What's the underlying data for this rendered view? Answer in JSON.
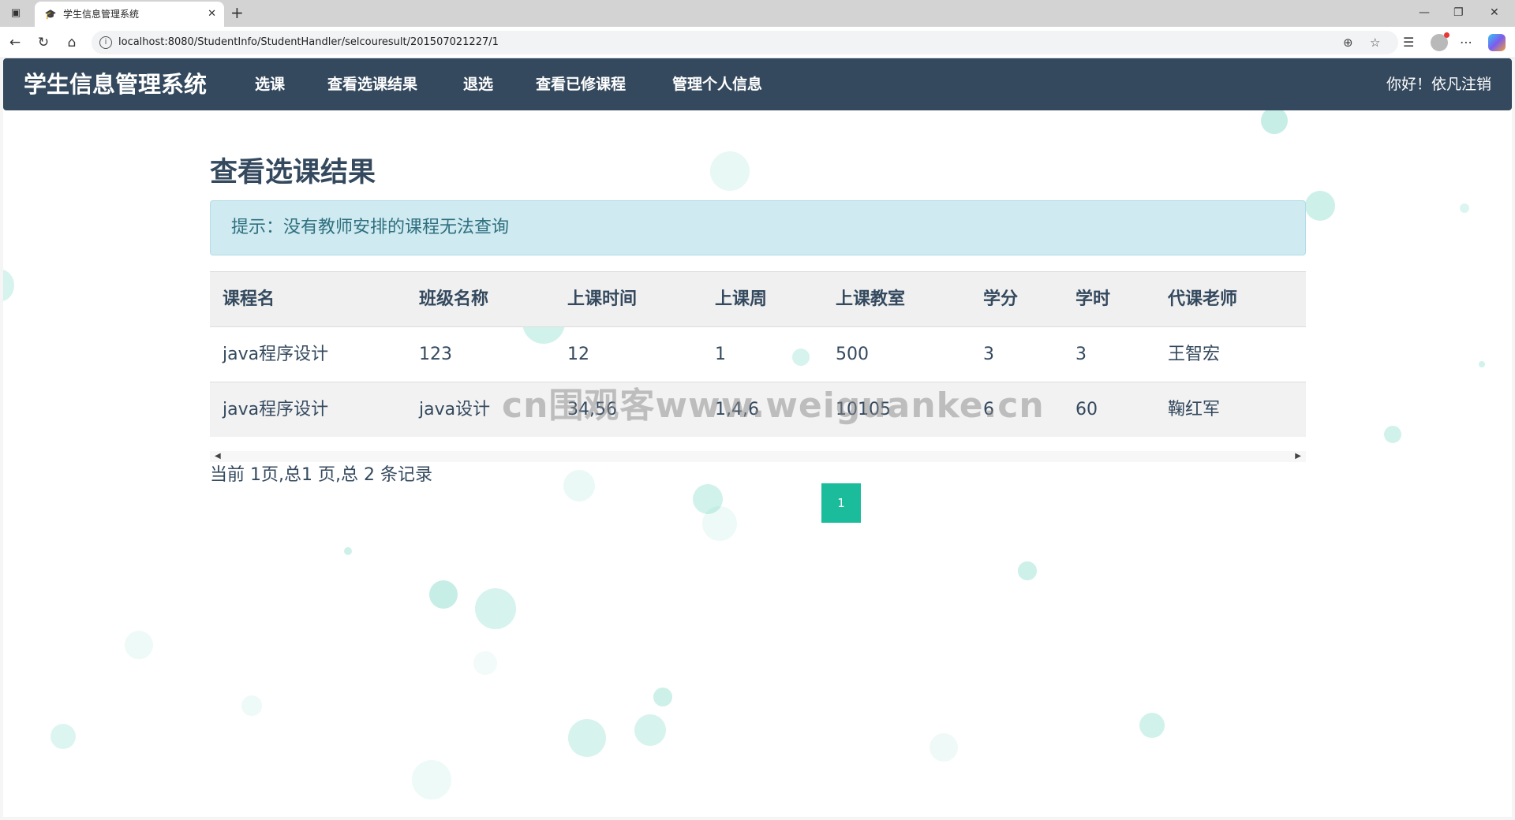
{
  "browser": {
    "tab_title": "学生信息管理系统",
    "tab_close": "✕",
    "new_tab": "+",
    "url": "localhost:8080/StudentInfo/StudentHandler/selcouresult/201507021227/1",
    "window_controls": {
      "minimize": "—",
      "restore": "❐",
      "close": "✕"
    }
  },
  "navbar": {
    "brand": "学生信息管理系统",
    "links": [
      "选课",
      "查看选课结果",
      "退选",
      "查看已修课程",
      "管理个人信息"
    ],
    "greeting": "你好！依凡注销"
  },
  "main": {
    "title": "查看选课结果",
    "alert": "提示：没有教师安排的课程无法查询",
    "table": {
      "headers": [
        "课程名",
        "班级名称",
        "上课时间",
        "上课周",
        "上课教室",
        "学分",
        "学时",
        "代课老师"
      ],
      "rows": [
        [
          "java程序设计",
          "123",
          "12",
          "1",
          "500",
          "3",
          "3",
          "王智宏"
        ],
        [
          "java程序设计",
          "java设计",
          "34,56",
          "1,4,6",
          "10105",
          "6",
          "60",
          "鞠红军"
        ]
      ]
    },
    "summary": "当前 1页,总1 页,总 2 条记录",
    "pagination": {
      "current": "1"
    }
  },
  "watermark": "cn围观客www.weiguanke.cn",
  "colors": {
    "navbar": "#34495e",
    "accent": "#1abc9c",
    "alert_bg": "#cfeaf0",
    "text": "#34495e"
  }
}
